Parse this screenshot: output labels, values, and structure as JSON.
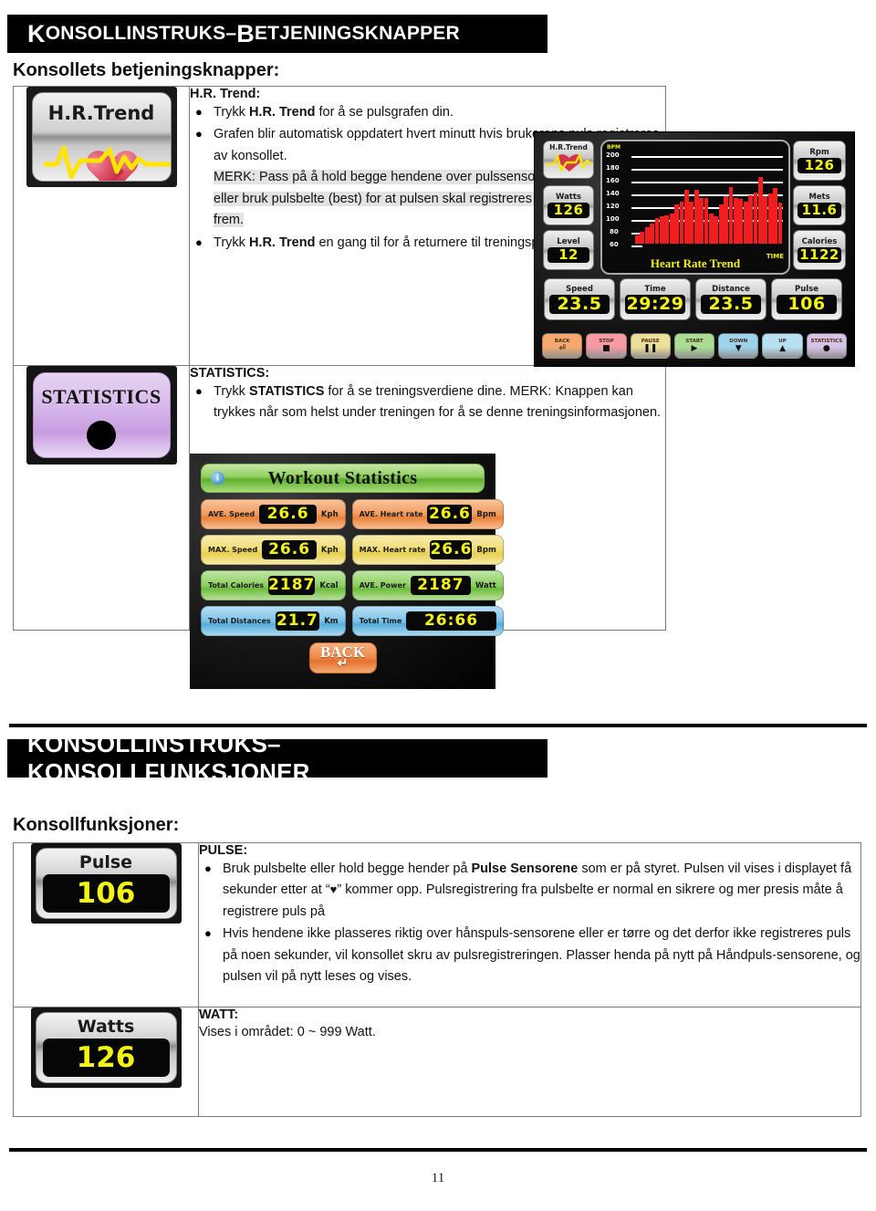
{
  "page": {
    "number": "11"
  },
  "section1": {
    "banner_part1": "K",
    "banner_rest1": "ONSOLLINSTRUKS",
    "banner_dash": " – ",
    "banner_part2": "B",
    "banner_rest2": "ETJENINGSKNAPPER",
    "banner_full": "KONSOLLINSTRUKS – BETJENINGSKNAPPER",
    "subhead": "Konsollets betjeningsknapper:",
    "hr_trend": {
      "heading": "H.R. Trend:",
      "bullet1_pre": "Trykk ",
      "bullet1_bold": "H.R. Trend",
      "bullet1_post": " for å se pulsgrafen din.",
      "bullet2": "Grafen blir automatisk oppdatert hvert minutt hvis brukerens puls registreres av konsollet.",
      "note": "MERK: Pass på å hold begge hendene over pulssensorene på håndtakene eller bruk pulsbelte (best) for at pulsen skal registreres og grafen komme frem.",
      "bullet3_pre": "Trykk ",
      "bullet3_bold": "H.R. Trend",
      "bullet3_post": " en gang til for å returnere til treningsprogrammet."
    },
    "statistics": {
      "heading": "STATISTICS:",
      "bullet1_pre": "Trykk ",
      "bullet1_bold": "STATISTICS",
      "bullet1_post": " for å se treningsverdiene dine. MERK: Knappen kan trykkes når som helst under treningen for å se denne treningsinformasjonen."
    }
  },
  "section2": {
    "banner_full": "KONSOLLINSTRUKS– KONSOLLFUNKSJONER",
    "subhead": "Konsollfunksjoner:",
    "pulse": {
      "heading": "PULSE:",
      "bullet1_a": "Bruk pulsbelte eller hold begge hender på ",
      "bullet1_bold": "Pulse Sensorene",
      "bullet1_b": " som er på styret. Pulsen vil vises i displayet få sekunder etter at “",
      "bullet1_heart": "♥",
      "bullet1_c": "” kommer opp. Pulsregistrering fra pulsbelte er normal en sikrere og mer presis måte å registrere puls på",
      "bullet2": "Hvis hendene ikke plasseres riktig over hånspuls-sensorene eller er tørre og det derfor ikke registreres puls på noen sekunder, vil konsollet skru av pulsregistreringen. Plasser henda på nytt på Håndpuls-sensorene, og pulsen vil på nytt leses og vises."
    },
    "watt": {
      "heading": "WATT:",
      "text": "Vises i området: 0 ~ 999 Watt."
    }
  },
  "hr_trend_button": {
    "label": "H.R.Trend",
    "icon": "heart-ecg-icon"
  },
  "statistics_button": {
    "label": "STATISTICS"
  },
  "pulse_display": {
    "label": "Pulse",
    "value": "106"
  },
  "watts_display": {
    "label": "Watts",
    "value": "126"
  },
  "console": {
    "hr_tile_label": "H.R.Trend",
    "left_tiles": [
      {
        "label": "Watts",
        "value": "126"
      },
      {
        "label": "Level",
        "value": "12"
      }
    ],
    "right_tiles": [
      {
        "label": "Rpm",
        "value": "126"
      },
      {
        "label": "Mets",
        "value": "11.6"
      },
      {
        "label": "Calories",
        "value": "1122"
      }
    ],
    "bottom_tiles": [
      {
        "label": "Speed",
        "value": "23.5"
      },
      {
        "label": "Time",
        "value": "29:29"
      },
      {
        "label": "Distance",
        "value": "23.5"
      },
      {
        "label": "Pulse",
        "value": "106"
      }
    ],
    "keys": [
      {
        "label": "BACK",
        "glyph": "⏎",
        "color": "#f6a96e"
      },
      {
        "label": "STOP",
        "glyph": "■",
        "color": "#f59ba3"
      },
      {
        "label": "PAUSE",
        "glyph": "❚❚",
        "color": "#ecdf9a"
      },
      {
        "label": "START",
        "glyph": "▶",
        "color": "#aadd93"
      },
      {
        "label": "DOWN",
        "glyph": "▼",
        "color": "#9ed3ee"
      },
      {
        "label": "UP",
        "glyph": "▲",
        "color": "#b8e0f3"
      },
      {
        "label": "STATISTICS",
        "glyph": "●",
        "color": "#d8c3e8"
      }
    ]
  },
  "chart_data": {
    "type": "bar",
    "title": "Heart Rate Trend",
    "ylabel": "BPM",
    "xlabel": "TIME",
    "ylim": [
      60,
      200
    ],
    "yticks": [
      "200",
      "180",
      "160",
      "140",
      "120",
      "100",
      "80",
      "60"
    ],
    "gridlines": true,
    "legend": "none",
    "x": [
      1,
      2,
      3,
      4,
      5,
      6,
      7,
      8,
      9,
      10,
      11,
      12,
      13,
      14,
      15,
      16,
      17,
      18,
      19,
      20,
      21,
      22,
      23,
      24,
      25,
      26,
      27,
      28,
      29,
      30
    ],
    "values": [
      72,
      78,
      84,
      90,
      98,
      100,
      102,
      104,
      118,
      122,
      140,
      122,
      140,
      128,
      128,
      104,
      100,
      118,
      130,
      144,
      128,
      126,
      122,
      132,
      136,
      158,
      130,
      134,
      142,
      120
    ]
  },
  "workout_statistics": {
    "title": "Workout Statistics",
    "rows": [
      {
        "label": "AVE. Speed",
        "value": "26.6",
        "unit": "Kph",
        "label2": "AVE. Heart rate",
        "value2": "26.6",
        "unit2": "Bpm",
        "tone": "wc-orange"
      },
      {
        "label": "MAX. Speed",
        "value": "26.6",
        "unit": "Kph",
        "label2": "MAX. Heart rate",
        "value2": "26.6",
        "unit2": "Bpm",
        "tone": "wc-yellow"
      },
      {
        "label": "Total Calories",
        "value": "2187",
        "unit": "Kcal",
        "label2": "AVE. Power",
        "value2": "2187",
        "unit2": "Watt",
        "tone": "wc-green"
      },
      {
        "label": "Total Distances",
        "value": "21.7",
        "unit": "Km",
        "label2": "Total Time",
        "value2": "26:66",
        "unit2": "",
        "tone": "wc-blue"
      }
    ],
    "back_label": "BACK"
  }
}
